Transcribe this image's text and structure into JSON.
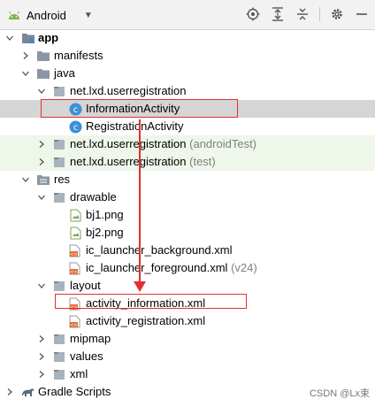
{
  "toolbar": {
    "view_label": "Android",
    "icons": [
      "locate-icon",
      "expand-all-icon",
      "collapse-all-icon",
      "settings-icon",
      "hide-icon"
    ]
  },
  "tree": [
    {
      "label": "app",
      "bold": true,
      "icon": "module-folder-icon",
      "expanded": true
    },
    {
      "label": "manifests",
      "icon": "folder-icon",
      "expanded": false
    },
    {
      "label": "java",
      "icon": "folder-icon",
      "expanded": true
    },
    {
      "label": "net.lxd.userregistration",
      "icon": "package-icon",
      "expanded": true
    },
    {
      "label": "InformationActivity",
      "icon": "class-icon",
      "selected": true
    },
    {
      "label": "RegistrationActivity",
      "icon": "class-icon"
    },
    {
      "label": "net.lxd.userregistration",
      "suffix": "(androidTest)",
      "icon": "package-icon",
      "expanded": false
    },
    {
      "label": "net.lxd.userregistration",
      "suffix": "(test)",
      "icon": "package-icon",
      "expanded": false
    },
    {
      "label": "res",
      "icon": "res-folder-icon",
      "expanded": true
    },
    {
      "label": "drawable",
      "icon": "folder-icon",
      "expanded": true
    },
    {
      "label": "bj1.png",
      "icon": "image-file-icon"
    },
    {
      "label": "bj2.png",
      "icon": "image-file-icon"
    },
    {
      "label": "ic_launcher_background.xml",
      "icon": "xml-file-icon"
    },
    {
      "label": "ic_launcher_foreground.xml",
      "suffix": "(v24)",
      "icon": "xml-file-icon"
    },
    {
      "label": "layout",
      "icon": "folder-icon",
      "expanded": true
    },
    {
      "label": "activity_information.xml",
      "icon": "xml-file-icon"
    },
    {
      "label": "activity_registration.xml",
      "icon": "xml-file-icon"
    },
    {
      "label": "mipmap",
      "icon": "folder-icon",
      "expanded": false
    },
    {
      "label": "values",
      "icon": "folder-icon",
      "expanded": false
    },
    {
      "label": "xml",
      "icon": "folder-icon",
      "expanded": false
    },
    {
      "label": "Gradle Scripts",
      "icon": "gradle-icon",
      "expanded": false
    }
  ],
  "watermark": "CSDN @Lx束",
  "colors": {
    "accent_red": "#e03030",
    "selection": "#d5d5d5",
    "test_bg": "#eef7ea",
    "class_icon": "#3d8fd8"
  }
}
